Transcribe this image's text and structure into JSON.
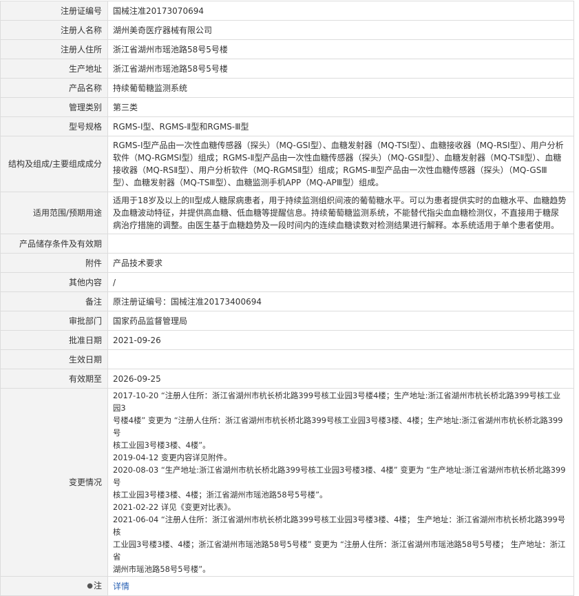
{
  "rows": [
    {
      "label": "注册证编号",
      "value": "国械注准20173070694"
    },
    {
      "label": "注册人名称",
      "value": "湖州美奇医疗器械有限公司"
    },
    {
      "label": "注册人住所",
      "value": "浙江省湖州市瑶池路58号5号楼"
    },
    {
      "label": "生产地址",
      "value": "浙江省湖州市瑶池路58号5号楼"
    },
    {
      "label": "产品名称",
      "value": "持续葡萄糖监测系统"
    },
    {
      "label": "管理类别",
      "value": "第三类"
    },
    {
      "label": "型号规格",
      "value": "RGMS-Ⅰ型、RGMS-Ⅱ型和RGMS-Ⅲ型"
    },
    {
      "label": "结构及组成/主要组成成分",
      "value": "RGMS-Ⅰ型产品由一次性血糖传感器（探头）（MQ-GSⅠ型）、血糖发射器（MQ-TSⅠ型）、血糖接收器（MQ-RSⅠ型）、用户分析软件（MQ-RGMSⅠ型）组成；RGMS-Ⅱ型产品由一次性血糖传感器（探头）（MQ-GSⅡ型）、血糖发射器（MQ-TSⅡ型）、血糖接收器（MQ-RSⅡ型）、用户分析软件（MQ-RGMSⅡ型）组成；RGMS-Ⅲ型产品由一次性血糖传感器（探头）（MQ-GSⅢ型）、血糖发射器（MQ-TSⅢ型）、血糖监测手机APP（MQ-APⅢ型）组成。"
    },
    {
      "label": "适用范围/预期用途",
      "value": "适用于18岁及以上的II型成人糖尿病患者，用于持续监测组织间液的葡萄糖水平。可以为患者提供实时的血糖水平、血糖趋势及血糖波动特征，并提供高血糖、低血糖等提醒信息。持续葡萄糖监测系统，不能替代指尖血血糖检测仪，不直接用于糖尿病治疗措施的调整。由医生基于血糖趋势及一段时间内的连续血糖读数对检测结果进行解释。本系统适用于单个患者使用。"
    },
    {
      "label": "产品储存条件及有效期",
      "value": ""
    },
    {
      "label": "附件",
      "value": "产品技术要求"
    },
    {
      "label": "其他内容",
      "value": "/"
    },
    {
      "label": "备注",
      "value": "原注册证编号：国械注准20173400694"
    },
    {
      "label": "审批部门",
      "value": "国家药品监督管理局"
    },
    {
      "label": "批准日期",
      "value": "2021-09-26"
    },
    {
      "label": "生效日期",
      "value": ""
    },
    {
      "label": "有效期至",
      "value": "2026-09-25"
    }
  ],
  "changes": {
    "label": "变更情况",
    "lines": [
      "2017-10-20 “注册人住所：浙江省湖州市杭长桥北路399号核工业园3号楼4楼；生产地址:浙江省湖州市杭长桥北路399号核工业园3",
      "号楼4楼” 变更为 “注册人住所：浙江省湖州市杭长桥北路399号核工业园3号楼3楼、4楼；生产地址:浙江省湖州市杭长桥北路399号",
      "核工业园3号楼3楼、4楼”。",
      "2019-04-12 变更内容详见附件。",
      "2020-08-03 “生产地址:浙江省湖州市杭长桥北路399号核工业园3号楼3楼、4楼” 变更为 “生产地址:浙江省湖州市杭长桥北路399号",
      "核工业园3号楼3楼、4楼；浙江省湖州市瑶池路58号5号楼”。",
      "2021-02-22 详见《变更对比表》。",
      "2021-06-04 “注册人住所：浙江省湖州市杭长桥北路399号核工业园3号楼3楼、4楼； 生产地址：浙江省湖州市杭长桥北路399号核",
      "工业园3号楼3楼、4楼；浙江省湖州市瑶池路58号5号楼” 变更为 “注册人住所：浙江省湖州市瑶池路58号5号楼； 生产地址：浙江省",
      "湖州市瑶池路58号5号楼”。"
    ]
  },
  "note": {
    "label": "注",
    "icon": "pin-icon",
    "link_text": "详情",
    "link_color": "#2a62b4"
  },
  "colors": {
    "label_bg": "#f3f3f3",
    "border": "#dcdcdc",
    "text": "#333333"
  }
}
